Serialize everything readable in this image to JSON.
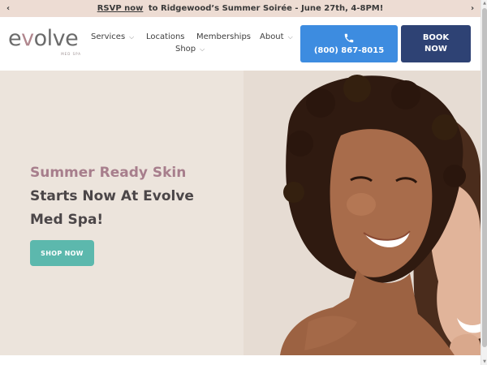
{
  "announcement": {
    "link_text": "RSVP now",
    "message": "to Ridgewood’s Summer Soirée - June 27th, 4-8PM!",
    "prev_icon": "chevron-left-icon",
    "next_icon": "chevron-right-icon"
  },
  "logo": {
    "word_start": "e",
    "word_accent": "v",
    "word_end": "olve",
    "sub": "MED SPA"
  },
  "nav": {
    "items": [
      {
        "label": "Services",
        "has_dropdown": true
      },
      {
        "label": "Locations",
        "has_dropdown": false
      },
      {
        "label": "Memberships",
        "has_dropdown": false
      },
      {
        "label": "About",
        "has_dropdown": true
      },
      {
        "label": "Shop",
        "has_dropdown": true
      }
    ],
    "chevron": "⌵"
  },
  "cta": {
    "phone_icon": "phone-icon",
    "phone": "(800) 867-8015",
    "book_line1": "BOOK",
    "book_line2": "NOW"
  },
  "hero": {
    "line1": "Summer Ready Skin",
    "line2": "Starts Now At Evolve",
    "line3": "Med Spa!",
    "button": "SHOP NOW"
  },
  "colors": {
    "announcement_bg": "#eddcd3",
    "phone_button": "#3d8ce0",
    "book_button": "#2e4274",
    "hero_bg": "#ece4dc",
    "hero_accent_text": "#a77e8c",
    "hero_dark_text": "#4b4648",
    "shop_button": "#5cb8ad"
  }
}
